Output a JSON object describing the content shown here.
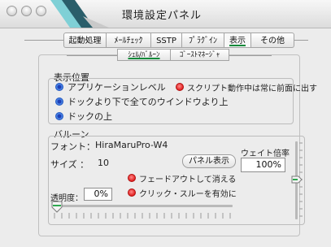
{
  "window": {
    "title": "環境設定パネル"
  },
  "tabs": [
    {
      "label": "起動処理"
    },
    {
      "label": "ﾒｰﾙﾁｪｯｸ"
    },
    {
      "label": "SSTP"
    },
    {
      "label": "ﾌﾟﾗｸﾞｲﾝ"
    },
    {
      "label": "表示",
      "active": true
    },
    {
      "label": "その他"
    }
  ],
  "subtabs": [
    {
      "label": "ｼｪﾙ/ﾊﾞﾙｰﾝ",
      "active": true
    },
    {
      "label": "ｺﾞｰｽﾄﾏﾈｰｼﾞｬ"
    }
  ],
  "display_position": {
    "heading": "表示位置",
    "options": [
      {
        "label": "アプリケーションレベル",
        "selected": true
      },
      {
        "label": "ドックより下で全てのウインドウより上",
        "selected": true
      },
      {
        "label": "ドックの上",
        "selected": true
      }
    ],
    "script_front": {
      "label": "スクリプト動作中は常に前面に出す",
      "checked": true
    }
  },
  "balloon": {
    "heading": "バルーン",
    "font_label": "フォント：",
    "font_value": "HiraMaruPro-W4",
    "size_label": "サイズ ：",
    "size_value": "10",
    "panel_button": "パネル表示",
    "wait_label": "ウェイト倍率",
    "wait_value": "100%",
    "fade_label": "フェードアウトして消える",
    "fade_checked": true,
    "clickthrough_label": "クリック・スルーを有効に",
    "clickthrough_checked": true,
    "opacity_label": "透明度：",
    "opacity_value": "0%"
  },
  "colors": {
    "accent_green": "#0a8a3a",
    "radio_blue": "#2f6bd6",
    "radio_red": "#e22020"
  }
}
